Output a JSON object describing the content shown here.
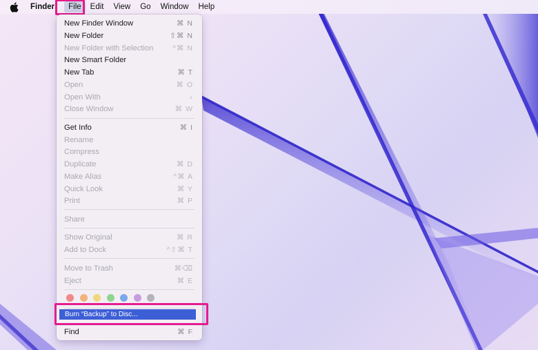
{
  "menubar": {
    "app_name": "Finder",
    "items": [
      "File",
      "Edit",
      "View",
      "Go",
      "Window",
      "Help"
    ]
  },
  "file_menu": {
    "items": [
      {
        "label": "New Finder Window",
        "shortcut": "⌘ N",
        "enabled": true
      },
      {
        "label": "New Folder",
        "shortcut": "⇧⌘ N",
        "enabled": true
      },
      {
        "label": "New Folder with Selection",
        "shortcut": "^⌘ N",
        "enabled": false
      },
      {
        "label": "New Smart Folder",
        "shortcut": "",
        "enabled": true
      },
      {
        "label": "New Tab",
        "shortcut": "⌘ T",
        "enabled": true
      },
      {
        "label": "Open",
        "shortcut": "⌘ O",
        "enabled": false
      },
      {
        "label": "Open With",
        "shortcut": "›",
        "enabled": false
      },
      {
        "label": "Close Window",
        "shortcut": "⌘ W",
        "enabled": false
      },
      {
        "label": "Get Info",
        "shortcut": "⌘ I",
        "enabled": true
      },
      {
        "label": "Rename",
        "shortcut": "",
        "enabled": false
      },
      {
        "label": "Compress",
        "shortcut": "",
        "enabled": false
      },
      {
        "label": "Duplicate",
        "shortcut": "⌘ D",
        "enabled": false
      },
      {
        "label": "Make Alias",
        "shortcut": "^⌘ A",
        "enabled": false
      },
      {
        "label": "Quick Look",
        "shortcut": "⌘ Y",
        "enabled": false
      },
      {
        "label": "Print",
        "shortcut": "⌘ P",
        "enabled": false
      },
      {
        "label": "Share",
        "shortcut": "",
        "enabled": false
      },
      {
        "label": "Show Original",
        "shortcut": "⌘ R",
        "enabled": false
      },
      {
        "label": "Add to Dock",
        "shortcut": "^⇧⌘ T",
        "enabled": false
      },
      {
        "label": "Move to Trash",
        "shortcut": "⌘⌫",
        "enabled": false
      },
      {
        "label": "Eject",
        "shortcut": "⌘ E",
        "enabled": false
      },
      {
        "label": "Burn “Backup” to Disc...",
        "shortcut": "",
        "enabled": true
      },
      {
        "label": "Find",
        "shortcut": "⌘ F",
        "enabled": true
      }
    ],
    "tag_colors": [
      "#ef8a8a",
      "#f2b37a",
      "#efd77a",
      "#8fd58f",
      "#7aa8ee",
      "#c89be0",
      "#b4b2ba"
    ]
  },
  "colors": {
    "highlight_box": "#e51b8e",
    "selection": "#3d5fd6"
  }
}
